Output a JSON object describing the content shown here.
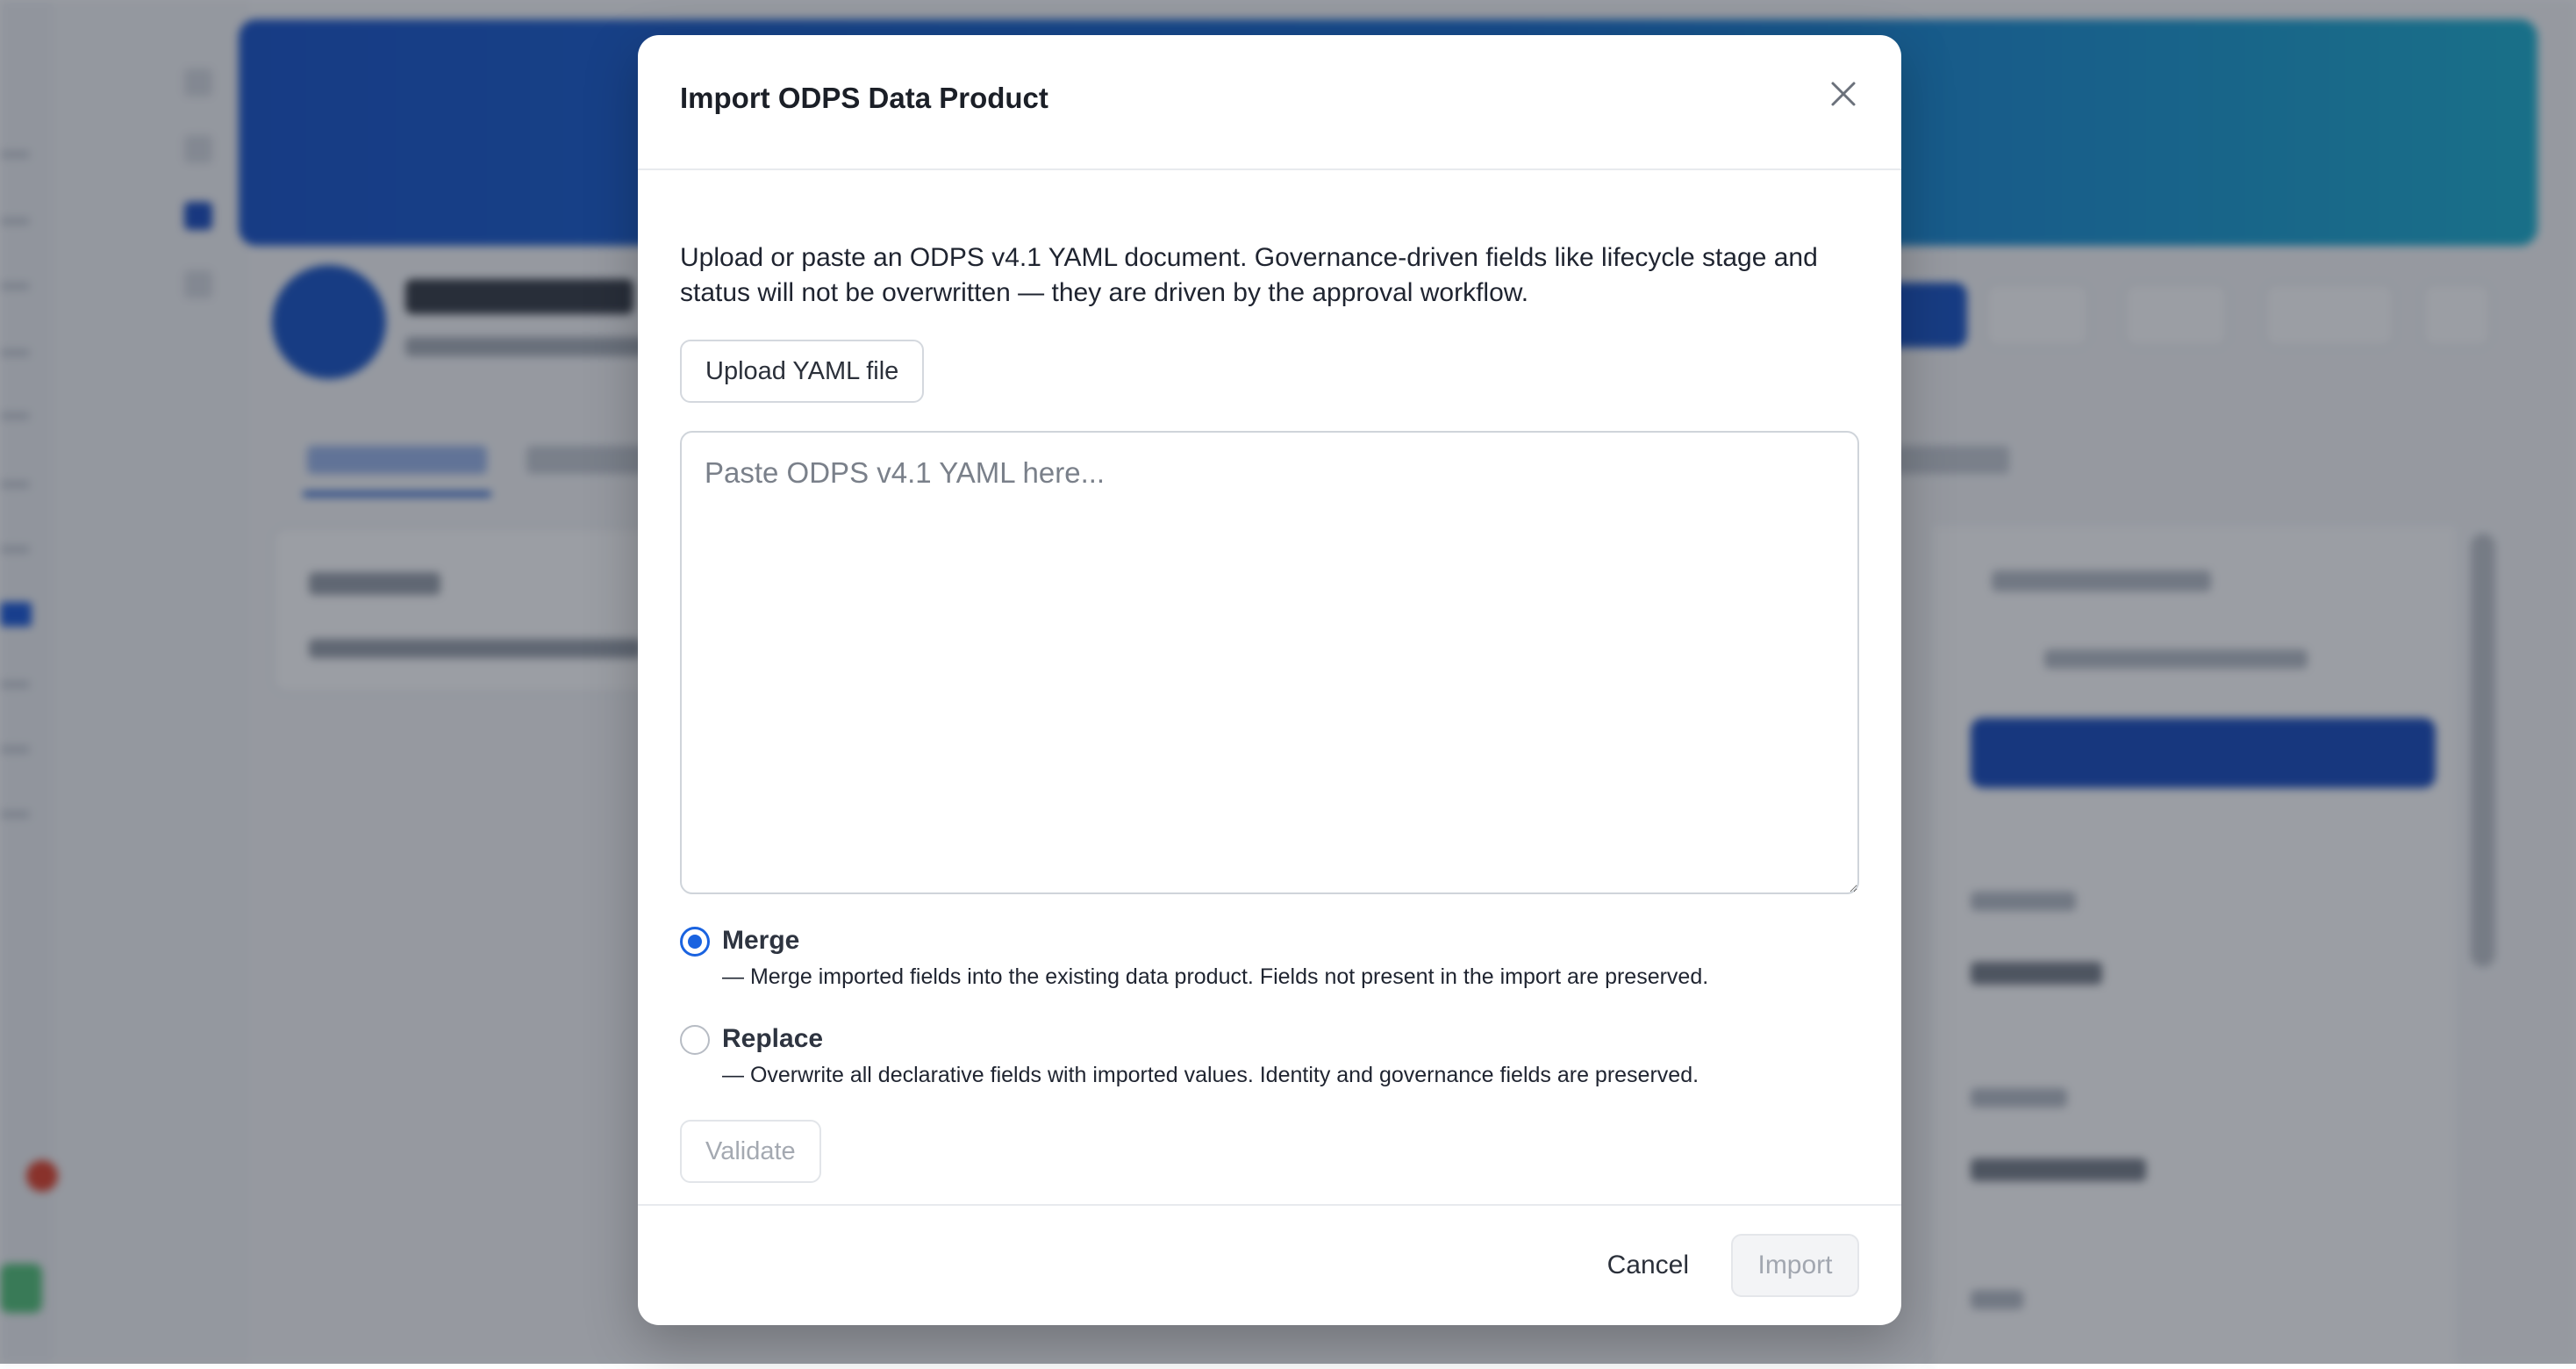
{
  "modal": {
    "title": "Import ODPS Data Product",
    "description": "Upload or paste an ODPS v4.1 YAML document. Governance-driven fields like lifecycle stage and status will not be overwritten — they are driven by the approval workflow.",
    "upload_label": "Upload YAML file",
    "textarea_placeholder": "Paste ODPS v4.1 YAML here...",
    "textarea_value": "",
    "options": [
      {
        "label": "Merge",
        "description": "— Merge imported fields into the existing data product. Fields not present in the import are preserved.",
        "selected": true
      },
      {
        "label": "Replace",
        "description": "— Overwrite all declarative fields with imported values. Identity and governance fields are preserved.",
        "selected": false
      }
    ],
    "validate_label": "Validate",
    "cancel_label": "Cancel",
    "import_label": "Import"
  },
  "colors": {
    "accent": "#1a63e0",
    "overlay": "rgba(17,24,39,0.42)",
    "banner_start": "#1d56c9",
    "banner_end": "#1fb0cf"
  },
  "icons": {
    "close": "close-icon"
  }
}
